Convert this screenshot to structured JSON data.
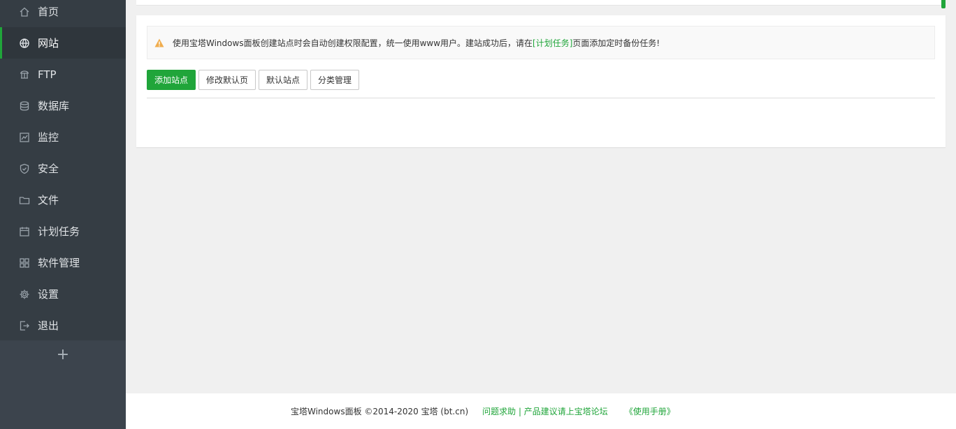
{
  "sidebar": {
    "items": [
      {
        "label": "首页",
        "icon": "home-icon"
      },
      {
        "label": "网站",
        "icon": "globe-icon",
        "active": true
      },
      {
        "label": "FTP",
        "icon": "ftp-icon"
      },
      {
        "label": "数据库",
        "icon": "database-icon"
      },
      {
        "label": "监控",
        "icon": "monitor-icon"
      },
      {
        "label": "安全",
        "icon": "shield-icon"
      },
      {
        "label": "文件",
        "icon": "folder-icon"
      },
      {
        "label": "计划任务",
        "icon": "calendar-icon"
      },
      {
        "label": "软件管理",
        "icon": "apps-icon"
      },
      {
        "label": "设置",
        "icon": "gear-icon"
      },
      {
        "label": "退出",
        "icon": "logout-icon"
      }
    ],
    "add_label": "+"
  },
  "notice": {
    "text_before": "使用宝塔Windows面板创建站点时会自动创建权限配置，统一使用www用户。建站成功后，请在",
    "link": "[计划任务]",
    "text_after": "页面添加定时备份任务!"
  },
  "toolbar": {
    "add_site": "添加站点",
    "edit_default_page": "修改默认页",
    "default_site": "默认站点",
    "category_manage": "分类管理"
  },
  "footer": {
    "copyright": "宝塔Windows面板 ©2014-2020 宝塔 (bt.cn)",
    "forum_link": "问题求助 | 产品建议请上宝塔论坛",
    "manual_link": "《使用手册》"
  },
  "colors": {
    "accent": "#20a53a",
    "sidebar_bg": "#353d44",
    "warning": "#f0ad4e"
  }
}
